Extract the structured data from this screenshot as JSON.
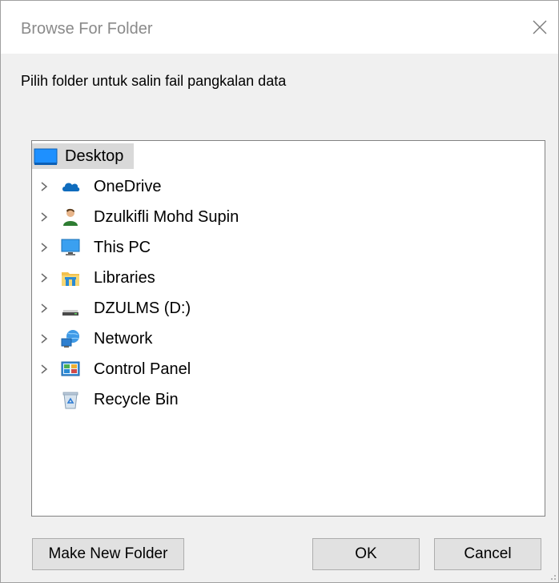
{
  "window": {
    "title": "Browse For Folder",
    "prompt": "Pilih folder untuk salin fail pangkalan data"
  },
  "tree": {
    "root": {
      "label": "Desktop",
      "icon": "desktop-icon",
      "selected": true
    },
    "items": [
      {
        "label": "OneDrive",
        "icon": "onedrive-cloud-icon",
        "expandable": true
      },
      {
        "label": "Dzulkifli Mohd Supin",
        "icon": "user-icon",
        "expandable": true
      },
      {
        "label": "This PC",
        "icon": "this-pc-icon",
        "expandable": true
      },
      {
        "label": "Libraries",
        "icon": "libraries-icon",
        "expandable": true
      },
      {
        "label": "DZULMS (D:)",
        "icon": "drive-icon",
        "expandable": true
      },
      {
        "label": "Network",
        "icon": "network-icon",
        "expandable": true
      },
      {
        "label": "Control Panel",
        "icon": "control-panel-icon",
        "expandable": true
      },
      {
        "label": "Recycle Bin",
        "icon": "recycle-bin-icon",
        "expandable": false
      }
    ]
  },
  "buttons": {
    "make_new_folder": "Make New Folder",
    "ok": "OK",
    "cancel": "Cancel"
  },
  "colors": {
    "selection": "#d9d9d9",
    "onedrive_blue": "#0f6cbd",
    "monitor_blue": "#1e90ff"
  }
}
